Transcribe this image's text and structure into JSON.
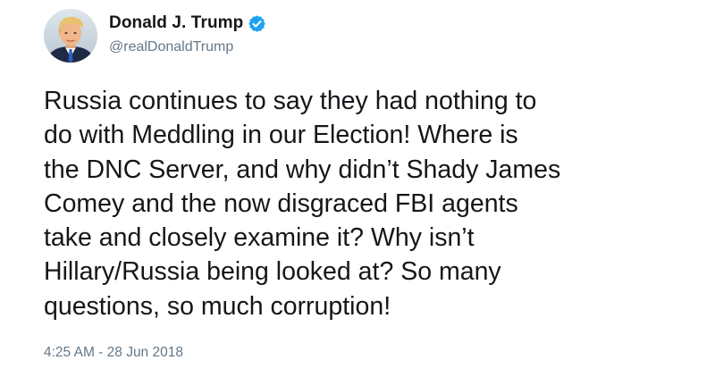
{
  "user": {
    "display_name": "Donald J. Trump",
    "handle": "@realDonaldTrump",
    "verified_icon": "verified-badge-icon",
    "avatar_icon": "avatar-photo"
  },
  "tweet": {
    "text": "Russia continues to say they had nothing to\ndo with Meddling in our Election! Where is\nthe DNC Server, and why didn’t Shady James\nComey and the now disgraced FBI agents\ntake and closely examine it? Why isn’t\nHillary/Russia being looked at? So many\nquestions, so much corruption!",
    "timestamp": "4:25 AM - 28 Jun 2018"
  },
  "colors": {
    "text": "#14171a",
    "secondary_text": "#657786",
    "verified_blue": "#1da1f2",
    "background": "#ffffff"
  }
}
